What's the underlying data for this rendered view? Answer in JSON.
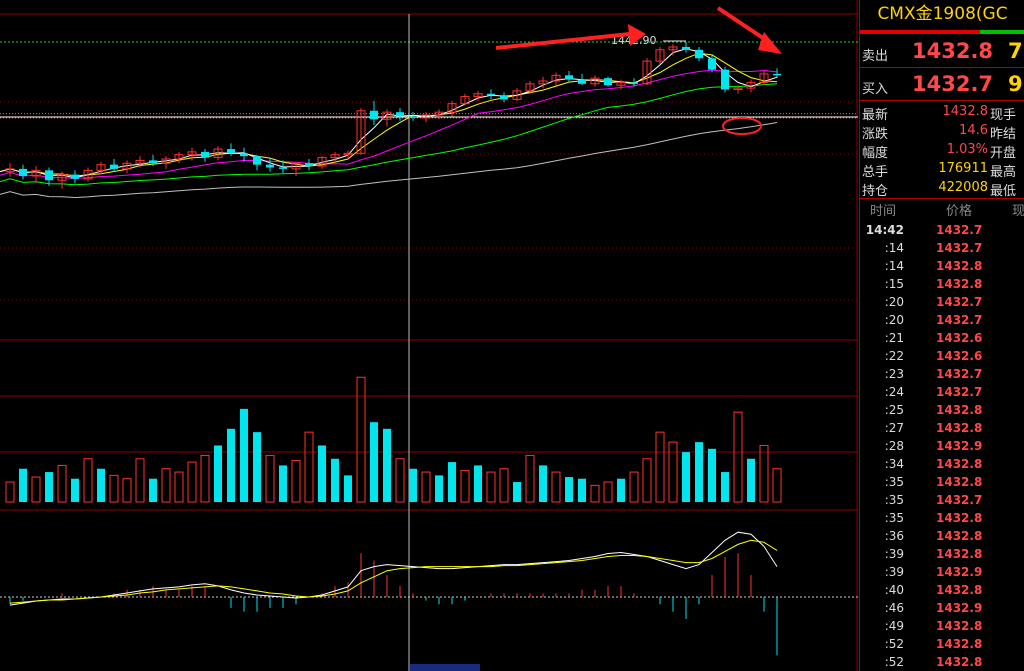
{
  "colors": {
    "up": "#ff3030",
    "down": "#00e5ee",
    "ma5": "#ffffff",
    "ma10": "#ffff00",
    "ma20": "#ff00ff",
    "ma40": "#00ff00",
    "ma60": "#c0c0c0",
    "grid": "#8b0000",
    "annot": "#ff2020"
  },
  "chart_data": {
    "type": "candlestick",
    "price_range": [
      1402,
      1446
    ],
    "high_label": "1442.90",
    "candles": [
      [
        1424.6,
        1425.8,
        1423.9,
        1425.0
      ],
      [
        1425.0,
        1425.6,
        1423.5,
        1424.0
      ],
      [
        1424.0,
        1425.4,
        1423.0,
        1424.8
      ],
      [
        1424.8,
        1425.2,
        1422.6,
        1423.4
      ],
      [
        1423.4,
        1424.6,
        1422.2,
        1424.2
      ],
      [
        1424.2,
        1424.8,
        1423.0,
        1423.6
      ],
      [
        1423.6,
        1425.2,
        1423.2,
        1424.8
      ],
      [
        1424.8,
        1426.0,
        1424.2,
        1425.6
      ],
      [
        1425.6,
        1426.4,
        1424.6,
        1425.0
      ],
      [
        1425.0,
        1426.2,
        1424.4,
        1425.8
      ],
      [
        1425.8,
        1426.8,
        1425.2,
        1426.2
      ],
      [
        1426.2,
        1427.0,
        1425.4,
        1425.8
      ],
      [
        1425.8,
        1426.8,
        1425.0,
        1426.4
      ],
      [
        1426.4,
        1427.4,
        1425.8,
        1427.0
      ],
      [
        1427.0,
        1428.0,
        1426.2,
        1427.4
      ],
      [
        1427.4,
        1427.8,
        1426.0,
        1426.6
      ],
      [
        1426.6,
        1428.2,
        1426.2,
        1427.8
      ],
      [
        1427.8,
        1428.6,
        1426.8,
        1427.2
      ],
      [
        1427.2,
        1428.0,
        1426.0,
        1426.8
      ],
      [
        1426.8,
        1426.9,
        1424.8,
        1425.6
      ],
      [
        1425.6,
        1426.6,
        1424.6,
        1425.2
      ],
      [
        1425.2,
        1426.2,
        1424.4,
        1425.0
      ],
      [
        1425.0,
        1426.0,
        1424.0,
        1425.8
      ],
      [
        1425.8,
        1426.4,
        1424.8,
        1425.4
      ],
      [
        1425.4,
        1426.8,
        1425.0,
        1426.6
      ],
      [
        1426.6,
        1427.4,
        1425.8,
        1427.0
      ],
      [
        1427.0,
        1427.6,
        1426.4,
        1427.2
      ],
      [
        1427.2,
        1433.6,
        1427.0,
        1433.2
      ],
      [
        1433.2,
        1434.6,
        1431.2,
        1432.0
      ],
      [
        1432.0,
        1433.4,
        1431.0,
        1433.0
      ],
      [
        1433.0,
        1433.6,
        1431.8,
        1432.4
      ],
      [
        1432.4,
        1433.0,
        1431.8,
        1432.2
      ],
      [
        1432.2,
        1433.0,
        1431.6,
        1432.6
      ],
      [
        1432.6,
        1433.4,
        1432.0,
        1433.0
      ],
      [
        1433.0,
        1434.6,
        1432.4,
        1434.2
      ],
      [
        1434.2,
        1435.6,
        1434.0,
        1435.2
      ],
      [
        1435.2,
        1436.0,
        1434.6,
        1435.6
      ],
      [
        1435.6,
        1436.2,
        1434.8,
        1435.4
      ],
      [
        1435.4,
        1435.8,
        1434.4,
        1434.8
      ],
      [
        1434.8,
        1436.4,
        1434.6,
        1436.0
      ],
      [
        1436.0,
        1437.4,
        1435.6,
        1437.0
      ],
      [
        1437.0,
        1438.0,
        1436.4,
        1437.4
      ],
      [
        1437.4,
        1438.6,
        1436.8,
        1438.2
      ],
      [
        1438.2,
        1438.8,
        1437.2,
        1437.6
      ],
      [
        1437.6,
        1438.4,
        1436.8,
        1437.0
      ],
      [
        1437.0,
        1438.2,
        1436.6,
        1437.8
      ],
      [
        1437.8,
        1438.0,
        1436.6,
        1436.8
      ],
      [
        1436.8,
        1437.6,
        1436.2,
        1437.2
      ],
      [
        1437.2,
        1437.8,
        1436.6,
        1437.0
      ],
      [
        1437.0,
        1440.6,
        1436.8,
        1440.2
      ],
      [
        1440.2,
        1442.2,
        1439.8,
        1441.8
      ],
      [
        1441.8,
        1442.6,
        1441.0,
        1442.2
      ],
      [
        1442.2,
        1442.9,
        1441.4,
        1441.8
      ],
      [
        1441.8,
        1442.2,
        1440.2,
        1440.6
      ],
      [
        1440.6,
        1441.2,
        1438.6,
        1439.0
      ],
      [
        1439.0,
        1439.4,
        1435.8,
        1436.2
      ],
      [
        1436.2,
        1436.8,
        1435.6,
        1436.4
      ],
      [
        1436.4,
        1437.6,
        1435.8,
        1437.2
      ],
      [
        1437.2,
        1438.8,
        1436.8,
        1438.4
      ],
      [
        1438.4,
        1439.2,
        1437.8,
        1438.2
      ]
    ],
    "volume_max": 95,
    "volumes": [
      12,
      20,
      15,
      18,
      22,
      14,
      26,
      20,
      16,
      14,
      26,
      14,
      20,
      18,
      24,
      28,
      34,
      44,
      56,
      42,
      28,
      22,
      25,
      42,
      34,
      26,
      16,
      75,
      48,
      44,
      26,
      20,
      18,
      16,
      24,
      19,
      22,
      18,
      20,
      12,
      28,
      22,
      18,
      15,
      14,
      10,
      12,
      14,
      18,
      26,
      42,
      36,
      30,
      36,
      32,
      18,
      54,
      26,
      34,
      20
    ],
    "volume_up": [
      true,
      false,
      true,
      false,
      true,
      false,
      true,
      false,
      true,
      true,
      true,
      false,
      true,
      true,
      true,
      true,
      false,
      false,
      false,
      false,
      true,
      false,
      true,
      true,
      false,
      false,
      false,
      true,
      false,
      false,
      true,
      false,
      true,
      false,
      false,
      true,
      false,
      true,
      true,
      false,
      true,
      false,
      true,
      false,
      false,
      true,
      true,
      false,
      true,
      true,
      true,
      true,
      false,
      false,
      false,
      false,
      true,
      false,
      true,
      true
    ],
    "macd_dif": [
      -0.8,
      -0.6,
      -0.4,
      -0.3,
      -0.2,
      -0.2,
      -0.1,
      0.0,
      0.2,
      0.4,
      0.6,
      0.8,
      0.9,
      1.0,
      1.2,
      1.3,
      1.1,
      0.7,
      0.4,
      0.2,
      0.1,
      0.0,
      -0.1,
      0.0,
      0.2,
      0.6,
      1.0,
      2.6,
      3.0,
      3.2,
      3.1,
      3.0,
      2.9,
      2.8,
      2.8,
      2.9,
      3.0,
      3.1,
      3.2,
      3.2,
      3.3,
      3.4,
      3.5,
      3.6,
      3.8,
      4.0,
      4.3,
      4.4,
      4.2,
      4.0,
      3.6,
      3.2,
      2.8,
      3.2,
      4.4,
      5.6,
      6.4,
      6.2,
      5.0,
      3.0
    ],
    "macd_dea": [
      -0.6,
      -0.5,
      -0.4,
      -0.3,
      -0.3,
      -0.2,
      -0.1,
      0.0,
      0.1,
      0.2,
      0.4,
      0.5,
      0.7,
      0.8,
      0.9,
      1.0,
      1.1,
      1.0,
      0.8,
      0.6,
      0.4,
      0.3,
      0.1,
      0.0,
      0.1,
      0.3,
      0.6,
      1.4,
      2.0,
      2.6,
      2.8,
      2.9,
      3.0,
      3.0,
      3.0,
      3.0,
      3.0,
      3.0,
      3.1,
      3.1,
      3.2,
      3.3,
      3.4,
      3.5,
      3.6,
      3.8,
      4.0,
      4.1,
      4.1,
      4.0,
      3.8,
      3.6,
      3.4,
      3.4,
      3.8,
      4.5,
      5.2,
      5.6,
      5.4,
      4.6
    ],
    "macd_range": [
      -8,
      8
    ]
  },
  "panel": {
    "title": "CMX金1908(GC",
    "sell_label": "卖出",
    "sell_price": "1432.8",
    "sell_vol": "7",
    "buy_label": "买入",
    "buy_price": "1432.7",
    "buy_vol": "9",
    "info": [
      {
        "label": "最新",
        "value": "1432.8",
        "label2": "现手",
        "yellow": false
      },
      {
        "label": "涨跌",
        "value": "14.6",
        "label2": "昨结",
        "yellow": false
      },
      {
        "label": "幅度",
        "value": "1.03%",
        "label2": "开盘",
        "yellow": false
      },
      {
        "label": "总手",
        "value": "176911",
        "label2": "最高",
        "yellow": true
      },
      {
        "label": "持仓",
        "value": "422008",
        "label2": "最低",
        "yellow": true
      }
    ],
    "hdr_time": "时间",
    "hdr_price": "价格",
    "hdr_vol": "现",
    "ticks": [
      {
        "t": "14:42",
        "p": "1432.7"
      },
      {
        "t": ":14",
        "p": "1432.7"
      },
      {
        "t": ":14",
        "p": "1432.8"
      },
      {
        "t": ":15",
        "p": "1432.8"
      },
      {
        "t": ":20",
        "p": "1432.7"
      },
      {
        "t": ":20",
        "p": "1432.7"
      },
      {
        "t": ":21",
        "p": "1432.6"
      },
      {
        "t": ":22",
        "p": "1432.6"
      },
      {
        "t": ":23",
        "p": "1432.7"
      },
      {
        "t": ":24",
        "p": "1432.7"
      },
      {
        "t": ":25",
        "p": "1432.8"
      },
      {
        "t": ":27",
        "p": "1432.8"
      },
      {
        "t": ":28",
        "p": "1432.9"
      },
      {
        "t": ":34",
        "p": "1432.8"
      },
      {
        "t": ":35",
        "p": "1432.8"
      },
      {
        "t": ":35",
        "p": "1432.7"
      },
      {
        "t": ":35",
        "p": "1432.8"
      },
      {
        "t": ":36",
        "p": "1432.8"
      },
      {
        "t": ":39",
        "p": "1432.8"
      },
      {
        "t": ":39",
        "p": "1432.9"
      },
      {
        "t": ":40",
        "p": "1432.8"
      },
      {
        "t": ":46",
        "p": "1432.9"
      },
      {
        "t": ":49",
        "p": "1432.8"
      },
      {
        "t": ":52",
        "p": "1432.8"
      },
      {
        "t": ":52",
        "p": "1432.8"
      }
    ]
  }
}
